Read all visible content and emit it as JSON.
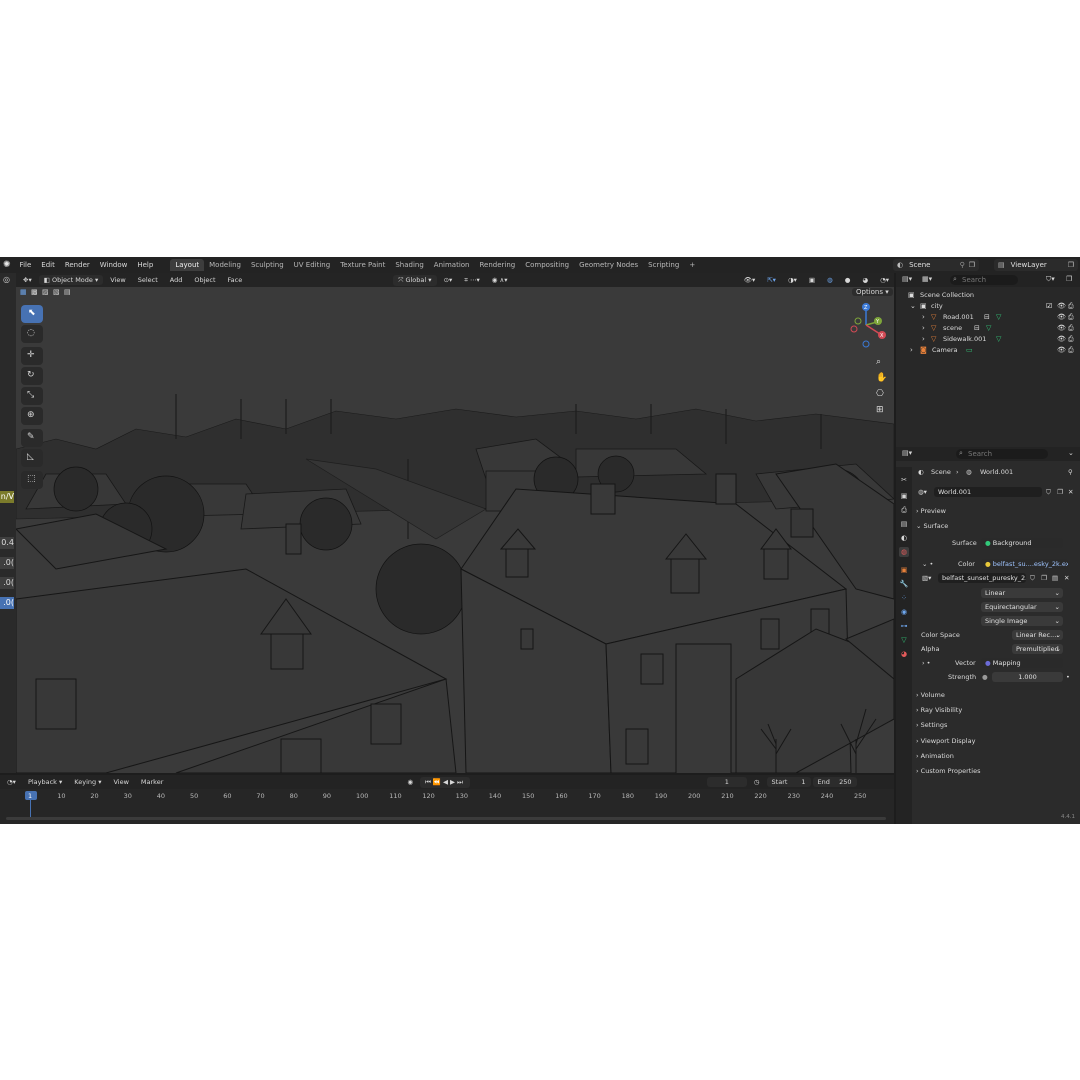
{
  "topbar": {
    "menus": [
      "File",
      "Edit",
      "Render",
      "Window",
      "Help"
    ],
    "workspaces": [
      "Layout",
      "Modeling",
      "Sculpting",
      "UV Editing",
      "Texture Paint",
      "Shading",
      "Animation",
      "Rendering",
      "Compositing",
      "Geometry Nodes",
      "Scripting"
    ],
    "active_workspace": "Layout",
    "add_tab": "+",
    "scene": "Scene",
    "view_layer": "ViewLayer"
  },
  "viewport": {
    "mode": "Object Mode",
    "menus": [
      "View",
      "Select",
      "Add",
      "Object",
      "Face"
    ],
    "transform_orientation": "Global",
    "options_label": "Options",
    "gizmo_z": "Z",
    "gizmo_y": "Y",
    "gizmo_x": "X"
  },
  "left_edge_values": [
    "n/V",
    "0.4",
    ".0(",
    ".0(",
    ".0("
  ],
  "timeline": {
    "menus": [
      "Playback",
      "Keying",
      "View",
      "Marker"
    ],
    "current_frame": "1",
    "start_label": "Start",
    "start": "1",
    "end_label": "End",
    "end": "250",
    "ticks": [
      "1",
      "10",
      "20",
      "30",
      "40",
      "50",
      "60",
      "70",
      "80",
      "90",
      "100",
      "110",
      "120",
      "130",
      "140",
      "150",
      "160",
      "170",
      "180",
      "190",
      "200",
      "210",
      "220",
      "230",
      "240",
      "250"
    ],
    "version": "4.4.1"
  },
  "outliner": {
    "search_placeholder": "Search",
    "root": "Scene Collection",
    "collection": "city",
    "items": [
      "Road.001",
      "scene",
      "Sidewalk.001"
    ],
    "camera": "Camera"
  },
  "properties": {
    "search_placeholder": "Search",
    "breadcrumb_scene": "Scene",
    "breadcrumb_world": "World.001",
    "world_name": "World.001",
    "panels_top": [
      "Preview",
      "Surface"
    ],
    "surface_label": "Surface",
    "surface_value": "Background",
    "color_label": "Color",
    "color_value": "belfast_su....esky_2k.exr",
    "image_name": "belfast_sunset_puresky_2...",
    "interpolation": "Linear",
    "projection": "Equirectangular",
    "source": "Single Image",
    "color_space_label": "Color Space",
    "color_space_value": "Linear Rec....",
    "alpha_label": "Alpha",
    "alpha_value": "Premultiplied",
    "vector_label": "Vector",
    "vector_value": "Mapping",
    "strength_label": "Strength",
    "strength_value": "1.000",
    "panels_bottom": [
      "Volume",
      "Ray Visibility",
      "Settings",
      "Viewport Display",
      "Animation",
      "Custom Properties"
    ]
  },
  "colors": {
    "accent": "#4772b3",
    "background": "#1d1d1d",
    "viewport": "#3a3a3a",
    "gizmo_z": "#3b79d6",
    "gizmo_y": "#7ea53a",
    "gizmo_x": "#d24a55",
    "mesh_icon": "#e8813a",
    "data_icon": "#32c97a"
  }
}
